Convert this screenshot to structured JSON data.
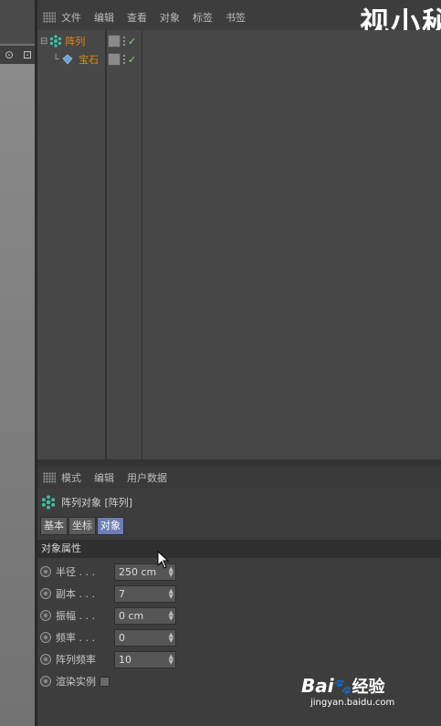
{
  "watermark": "视小秘",
  "viewport": {
    "toolbar_icons": [
      "⊙",
      "⊡"
    ]
  },
  "object_manager": {
    "menu": [
      "文件",
      "编辑",
      "查看",
      "对象",
      "标签",
      "书签"
    ],
    "objects": [
      {
        "name": "阵列",
        "icon": "array-icon"
      },
      {
        "name": "宝石",
        "icon": "gem-icon"
      }
    ]
  },
  "attribute_manager": {
    "menu": [
      "模式",
      "编辑",
      "用户数据"
    ],
    "title": "阵列对象 [阵列]",
    "tabs": [
      "基本",
      "坐标",
      "对象"
    ],
    "active_tab": "对象",
    "section": "对象属性",
    "params": [
      {
        "label": "半径 . . .",
        "value": "250 cm"
      },
      {
        "label": "副本 . . .",
        "value": "7"
      },
      {
        "label": "振幅 . . .",
        "value": "0 cm"
      },
      {
        "label": "频率 . . .",
        "value": "0"
      },
      {
        "label": "阵列频率",
        "value": "10"
      }
    ],
    "render_instances_label": "渲染实例"
  },
  "baidu": {
    "logo": "Bai",
    "paw": "🐾",
    "brand": "经验",
    "url": "jingyan.baidu.com"
  }
}
